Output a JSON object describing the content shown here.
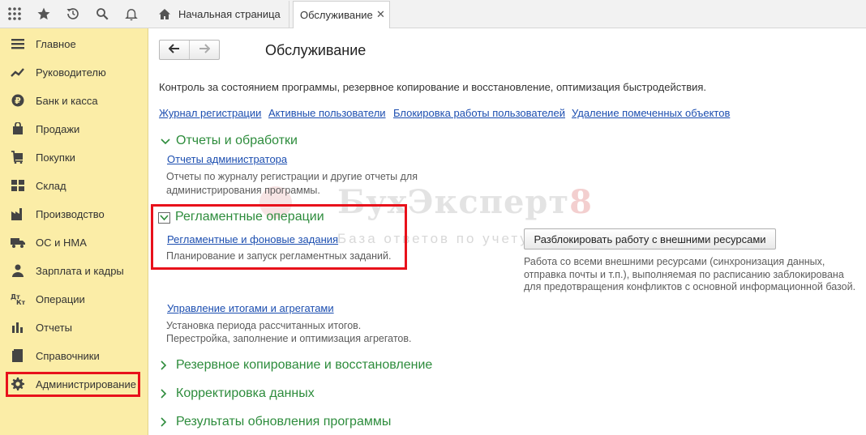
{
  "toolbar": {
    "icons": [
      "apps-grid-icon",
      "star-icon",
      "history-icon",
      "search-icon",
      "bell-icon"
    ]
  },
  "tabs": {
    "home_label": "Начальная страница",
    "active_label": "Обслуживание",
    "close_glyph": "✕"
  },
  "sidebar": {
    "items": [
      {
        "label": "Главное",
        "icon": "menu-icon"
      },
      {
        "label": "Руководителю",
        "icon": "trend-icon"
      },
      {
        "label": "Банк и касса",
        "icon": "ruble-icon"
      },
      {
        "label": "Продажи",
        "icon": "bag-icon"
      },
      {
        "label": "Покупки",
        "icon": "cart-icon"
      },
      {
        "label": "Склад",
        "icon": "warehouse-icon"
      },
      {
        "label": "Производство",
        "icon": "factory-icon"
      },
      {
        "label": "ОС и НМА",
        "icon": "truck-icon"
      },
      {
        "label": "Зарплата и кадры",
        "icon": "person-icon"
      },
      {
        "label": "Операции",
        "icon": "dt-kt-icon"
      },
      {
        "label": "Отчеты",
        "icon": "bar-chart-icon"
      },
      {
        "label": "Справочники",
        "icon": "book-icon"
      },
      {
        "label": "Администрирование",
        "icon": "gear-icon"
      }
    ],
    "highlighted": "Администрирование"
  },
  "main": {
    "title": "Обслуживание",
    "description": "Контроль за состоянием программы, резервное копирование и восстановление, оптимизация быстродействия.",
    "quick_links": [
      "Журнал регистрации",
      "Активные пользователи",
      "Блокировка работы пользователей",
      "Удаление помеченных объектов"
    ],
    "sections": {
      "reports": {
        "title": "Отчеты и обработки",
        "link": "Отчеты администратора",
        "desc1": "Отчеты по журналу регистрации и другие отчеты для",
        "desc2": "администрирования программы."
      },
      "routine": {
        "title": "Регламентные операции",
        "link": "Регламентные и фоновые задания",
        "desc": "Планирование и запуск регламентных заданий.",
        "button": "Разблокировать работу с внешними ресурсами",
        "button_desc1": "Работа со всеми внешними ресурсами (синхронизация данных,",
        "button_desc2": "отправка почты и т.п.), выполняемая по расписанию заблокирована",
        "button_desc3": "для предотвращения конфликтов с основной информационной базой.",
        "totals_link": "Управление итогами и агрегатами",
        "totals_desc1": "Установка периода рассчитанных итогов.",
        "totals_desc2": "Перестройка, заполнение и оптимизация агрегатов."
      },
      "collapsed": [
        "Резервное копирование и восстановление",
        "Корректировка данных",
        "Результаты обновления программы"
      ]
    }
  },
  "watermark": {
    "brand": "БухЭксперт",
    "brand_digit": "8",
    "tagline": "База ответов по учету"
  },
  "colors": {
    "sidebar_bg": "#fbeda7",
    "link": "#1c4eb0",
    "section_green": "#2d8c3c",
    "highlight_red": "#e8111b"
  }
}
